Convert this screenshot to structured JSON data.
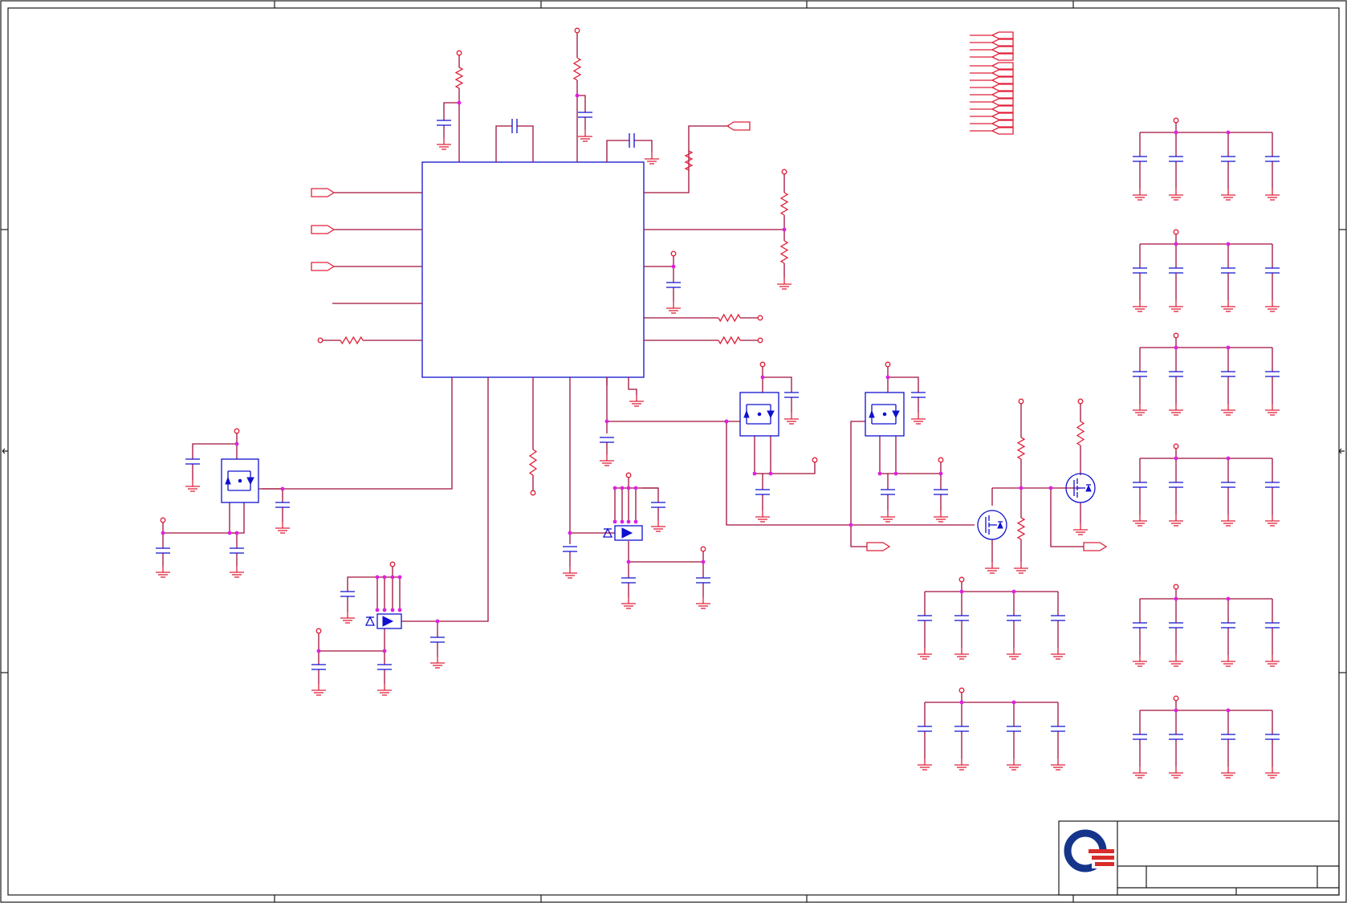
{
  "sheet": {
    "colors": {
      "wire": "#a0103a",
      "pin": "#e0203a",
      "component": "#1010d0",
      "junction": "#e020e0",
      "frame": "#1a1a1a",
      "logo_blue": "#14358a",
      "logo_red": "#d92c2c"
    },
    "icons": [
      "ic-chip-outline",
      "resistor-icon",
      "capacitor-icon",
      "ground-icon",
      "mosfet-icon",
      "power-port-icon",
      "net-flag-icon",
      "company-logo"
    ],
    "title_block": {
      "logo": "company-logo",
      "fields": []
    }
  }
}
